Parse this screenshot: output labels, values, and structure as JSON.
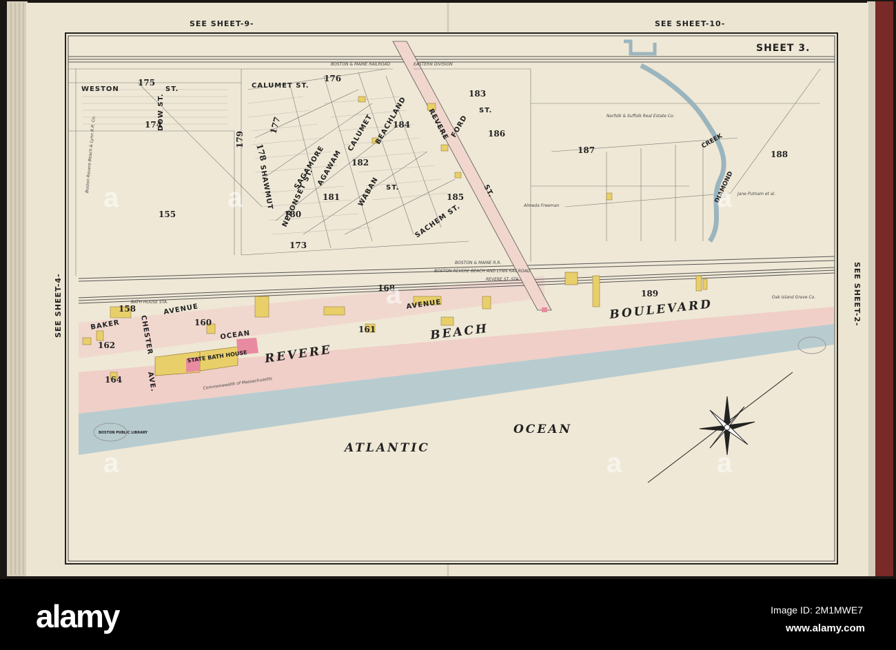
{
  "map": {
    "sheet_title": "SHEET 3.",
    "margin_refs": {
      "top_left": "SEE SHEET-9-",
      "top_right": "SEE SHEET-10-",
      "left": "SEE SHEET-4-",
      "right": "SEE SHEET-2-"
    },
    "water": [
      "ATLANTIC",
      "OCEAN",
      "DIAMOND",
      "CREEK"
    ],
    "railroads": [
      "BOSTON & MAINE RAILROAD",
      "EASTERN DIVISION",
      "BOSTON & MAINE R.R.",
      "BOSTON REVERE BEACH AND LYNN RAILROAD"
    ],
    "stations": [
      "BATH HOUSE STA.",
      "REVERE ST. STA."
    ],
    "streets": [
      "WESTON",
      "ST.",
      "CALUMET ST.",
      "DOW ST.",
      "SAGAMORE",
      "SHAWMUT",
      "NEPONSET ST.",
      "AGAWAM",
      "CALUMET",
      "BEACHLAND",
      "WABAN",
      "ST.",
      "REVERE",
      "FORD",
      "ST.",
      "SACHEM ST.",
      "ST.",
      "AVENUE",
      "BAKER",
      "CHESTER",
      "OCEAN",
      "AVENUE",
      "AVE.",
      "REVERE",
      "BEACH",
      "BOULEVARD"
    ],
    "buildings": [
      "STATE BATH HOUSE"
    ],
    "block_numbers": [
      "175",
      "176",
      "174",
      "177",
      "178",
      "179",
      "155",
      "180",
      "181",
      "182",
      "183",
      "184",
      "185",
      "186",
      "187",
      "188",
      "173",
      "158",
      "160",
      "162",
      "164",
      "161",
      "168",
      "189"
    ],
    "owners": [
      "Norfolk & Suffolk Real Estate Co.",
      "Jane Putnam et al.",
      "Almeda Freeman",
      "Oak Island Grove Co.",
      "Commonwealth of Massachusetts",
      "Boston Revere Beach & Lynn R.R. Co."
    ],
    "stamps": [
      "BOSTON PUBLIC LIBRARY"
    ]
  },
  "watermark": {
    "logo": "alamy",
    "image_id": "Image ID: 2M1MWE7",
    "site": "www.alamy.com"
  }
}
